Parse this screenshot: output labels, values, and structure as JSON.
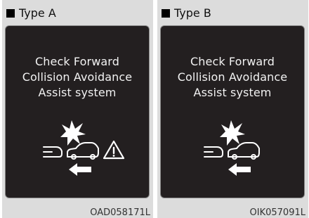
{
  "panels": [
    {
      "type_label": "Type A",
      "message_lines": [
        "Check Forward",
        "Collision Avoidance",
        "Assist system"
      ],
      "code": "OAD058171L",
      "icons": [
        "collision-star-icon",
        "rear-car-icon",
        "front-car-icon",
        "warning-triangle-icon",
        "left-arrow-icon"
      ]
    },
    {
      "type_label": "Type B",
      "message_lines": [
        "Check Forward",
        "Collision Avoidance",
        "Assist system"
      ],
      "code": "OIK057091L",
      "icons": [
        "collision-star-icon",
        "rear-car-icon",
        "front-car-icon",
        "left-arrow-icon"
      ]
    }
  ],
  "colors": {
    "panel_bg": "#dcdcdc",
    "screen_bg": "#231f20",
    "text_light": "#f2f2f2"
  }
}
